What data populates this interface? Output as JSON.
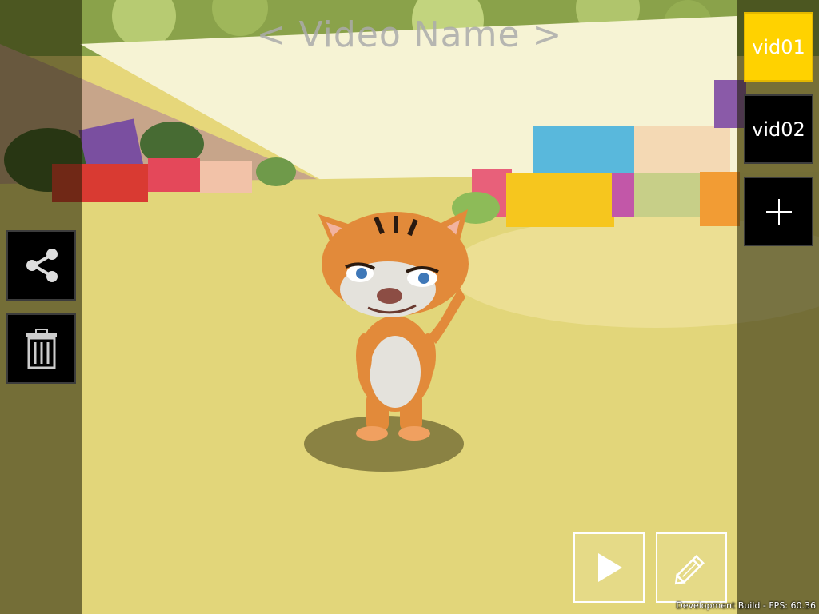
{
  "title": "< Video Name >",
  "videos": [
    {
      "label": "vid01",
      "active": true
    },
    {
      "label": "vid02",
      "active": false
    }
  ],
  "buttons": {
    "add_icon": "plus-icon",
    "share_icon": "share-icon",
    "delete_icon": "trash-icon",
    "play_icon": "play-icon",
    "edit_icon": "pencil-icon"
  },
  "status": {
    "fps_text": "Development Build - FPS: 60.36"
  },
  "colors": {
    "accent": "#ffd200",
    "panel_dark": "#000000",
    "ground": "#e6d77a"
  }
}
